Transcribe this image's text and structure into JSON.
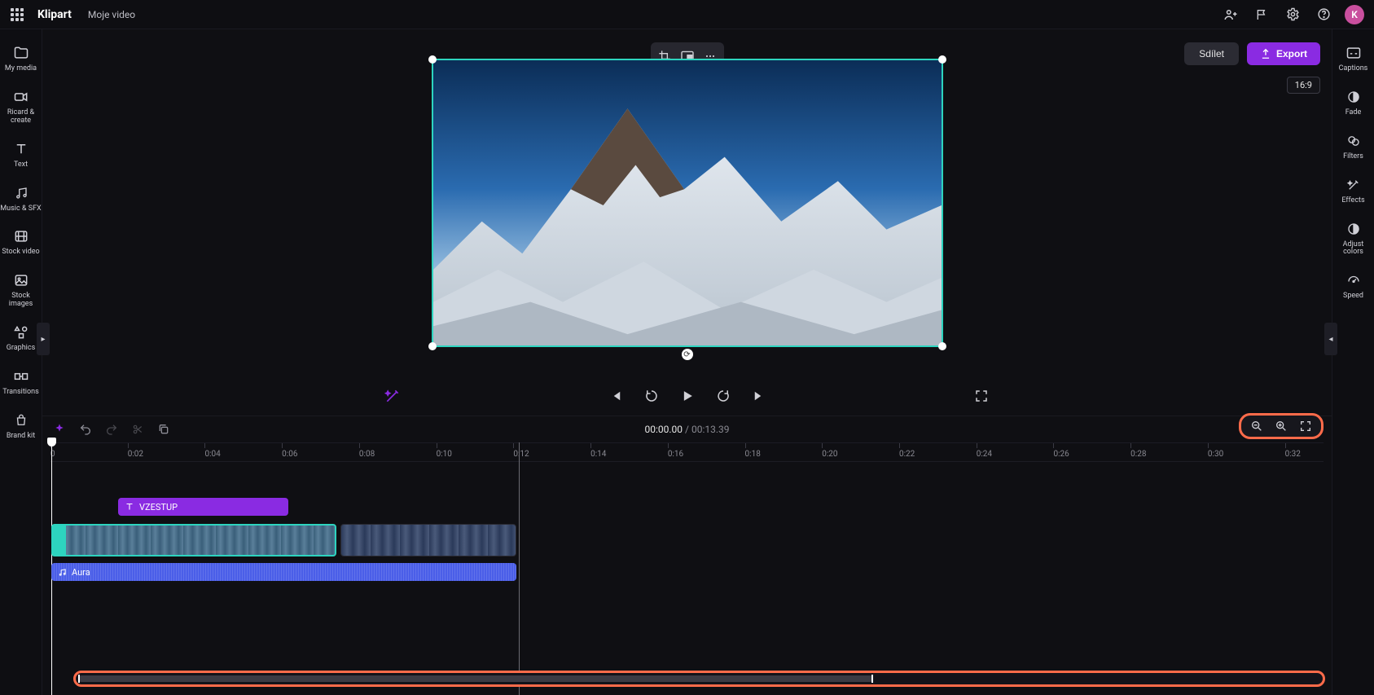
{
  "header": {
    "brand": "Klipart",
    "projectTitle": "Moje video",
    "avatarInitial": "K"
  },
  "leftRail": {
    "items": [
      {
        "label": "My media"
      },
      {
        "label": "Ricard & create"
      },
      {
        "label": "Text"
      },
      {
        "label": "Music & SFX"
      },
      {
        "label": "Stock video"
      },
      {
        "label": "Stock images"
      },
      {
        "label": "Graphics"
      },
      {
        "label": "Transitions"
      },
      {
        "label": "Brand kit"
      }
    ]
  },
  "rightRail": {
    "items": [
      {
        "label": "Captions"
      },
      {
        "label": "Fade"
      },
      {
        "label": "Filters"
      },
      {
        "label": "Effects"
      },
      {
        "label": "Adjust colors"
      },
      {
        "label": "Speed"
      }
    ]
  },
  "topRight": {
    "share": "Sdílet",
    "export": "Export",
    "aspect": "16:9"
  },
  "timecode": {
    "current": "00:00.00",
    "sep": " / ",
    "duration": "00:13.39"
  },
  "rulerTicks": [
    "0",
    "0:02",
    "0:04",
    "0:06",
    "0:08",
    "0:10",
    "0:12",
    "0:14",
    "0:16",
    "0:18",
    "0:20",
    "0:22",
    "0:24",
    "0:26",
    "0:28",
    "0:30",
    "0:32"
  ],
  "clips": {
    "textLabel": "VZESTUP",
    "audioLabel": "Aura"
  }
}
